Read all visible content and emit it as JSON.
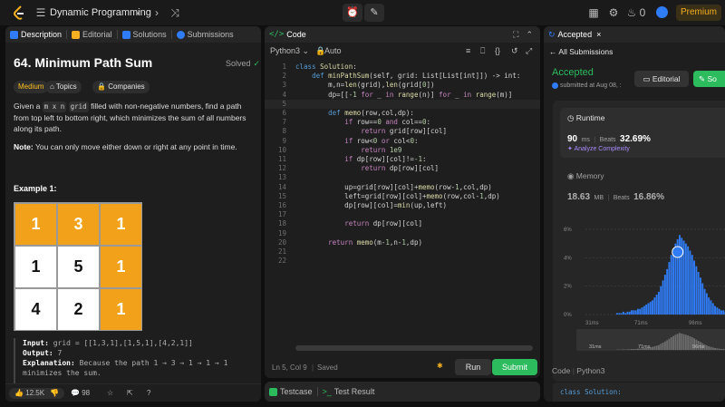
{
  "topbar": {
    "title": "Dynamic Programming",
    "flame_count": "0",
    "premium": "Premium"
  },
  "left_tabs": [
    "Description",
    "Editorial",
    "Solutions",
    "Submissions"
  ],
  "problem": {
    "title": "64. Minimum Path Sum",
    "status": "Solved",
    "chips": [
      "Medium",
      "Topics",
      "Companies"
    ],
    "desc_pre": "Given a",
    "desc_code1": "m x n",
    "desc_code2": "grid",
    "desc_post": "filled with non-negative numbers, find a path from top left to bottom right, which minimizes the sum of all numbers along its path.",
    "note_label": "Note:",
    "note_text": "You can only move either down or right at any point in time.",
    "example_label": "Example 1:",
    "grid": [
      [
        1,
        3,
        1
      ],
      [
        1,
        5,
        1
      ],
      [
        4,
        2,
        1
      ]
    ],
    "path": [
      [
        1,
        1,
        1
      ],
      [
        0,
        0,
        1
      ],
      [
        0,
        0,
        1
      ]
    ],
    "input_label": "Input:",
    "input_value": "grid = [[1,3,1],[1,5,1],[4,2,1]]",
    "output_label": "Output:",
    "output_value": "7",
    "explanation_label": "Explanation:",
    "explanation_text": "Because the path 1 → 3 → 1 → 1 → 1",
    "explanation_cont": "minimizes the sum.",
    "likes": "12.5K",
    "comments": "98"
  },
  "code_panel": {
    "tab": "Code",
    "language": "Python3",
    "mode": "Auto",
    "status_pos": "Ln 5, Col 9",
    "status_saved": "Saved",
    "run": "Run",
    "submit": "Submit",
    "lines": [
      "class Solution:",
      "    def minPathSum(self, grid: List[List[int]]) -> int:",
      "        m,n=len(grid),len(grid[0])",
      "        dp=[[-1 for _ in range(n)] for _ in range(m)]",
      "",
      "        def memo(row,col,dp):",
      "            if row==0 and col==0:",
      "                return grid[row][col]",
      "            if row<0 or col<0:",
      "                return 1e9",
      "            if dp[row][col]!=-1:",
      "                return dp[row][col]",
      "",
      "            up=grid[row][col]+memo(row-1,col,dp)",
      "            left=grid[row][col]+memo(row,col-1,dp)",
      "            dp[row][col]=min(up,left)",
      "",
      "            return dp[row][col]",
      "",
      "        return memo(m-1,n-1,dp)",
      "",
      ""
    ]
  },
  "bottom_tabs": [
    "Testcase",
    "Test Result"
  ],
  "result": {
    "tab": "Accepted",
    "all_submissions": "All Submissions",
    "status": "Accepted",
    "submitted": "submitted at Aug 08, :",
    "editorial": "Editorial",
    "solution_btn": "So",
    "runtime_label": "Runtime",
    "runtime_value": "90",
    "runtime_unit": "ms",
    "beats_label": "Beats",
    "runtime_beats": "32.69%",
    "analyze": "Analyze Complexity",
    "memory_label": "Memory",
    "memory_value": "18.63",
    "memory_unit": "MB",
    "memory_beats": "16.86%",
    "code_label": "Code",
    "code_lang": "Python3",
    "snippet": "class Solution:"
  },
  "chart_data": {
    "type": "bar",
    "y_ticks": [
      "6%",
      "4%",
      "2%",
      "0%"
    ],
    "x_ticks": [
      "31ms",
      "71ms",
      "96ms"
    ],
    "ylim": [
      0,
      6
    ],
    "values": [
      0.1,
      0.1,
      0.1,
      0.2,
      0.1,
      0.2,
      0.2,
      0.3,
      0.3,
      0.3,
      0.4,
      0.4,
      0.5,
      0.6,
      0.7,
      0.8,
      0.9,
      1.0,
      1.2,
      1.4,
      1.6,
      2.0,
      2.4,
      2.8,
      3.2,
      3.7,
      4.2,
      4.6,
      5.0,
      5.3,
      5.6,
      5.4,
      5.2,
      5.0,
      4.8,
      4.5,
      4.2,
      3.8,
      3.4,
      3.0,
      2.6,
      2.2,
      1.8,
      1.5,
      1.2,
      1.0,
      0.8,
      0.6,
      0.5,
      0.4,
      0.3,
      0.3,
      0.2
    ],
    "highlight_index": 29,
    "color": "#2f7cf6"
  },
  "colors": {
    "accent_green": "#2cbb5d",
    "medium_yellow": "#ffc01e",
    "premium_orange": "#f5b021",
    "grid_highlight": "#f2a21a"
  }
}
